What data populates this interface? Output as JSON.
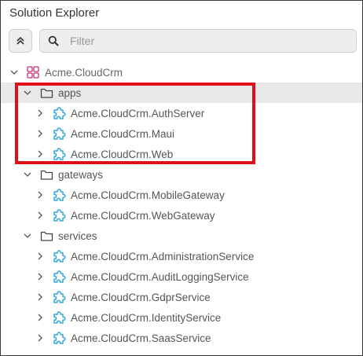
{
  "panel": {
    "title": "Solution Explorer",
    "filter_placeholder": "Filter",
    "filter_value": ""
  },
  "colors": {
    "project_icon": "#2fa8d8",
    "solution_icon": "#c0307a",
    "highlight_border": "#e0101b",
    "selected_row": "#e9e9e9"
  },
  "tree": {
    "solution": "Acme.CloudCrm",
    "folders": [
      {
        "name": "apps",
        "projects": [
          "Acme.CloudCrm.AuthServer",
          "Acme.CloudCrm.Maui",
          "Acme.CloudCrm.Web"
        ]
      },
      {
        "name": "gateways",
        "projects": [
          "Acme.CloudCrm.MobileGateway",
          "Acme.CloudCrm.WebGateway"
        ]
      },
      {
        "name": "services",
        "projects": [
          "Acme.CloudCrm.AdministrationService",
          "Acme.CloudCrm.AuditLoggingService",
          "Acme.CloudCrm.GdprService",
          "Acme.CloudCrm.IdentityService",
          "Acme.CloudCrm.SaasService"
        ]
      }
    ]
  }
}
